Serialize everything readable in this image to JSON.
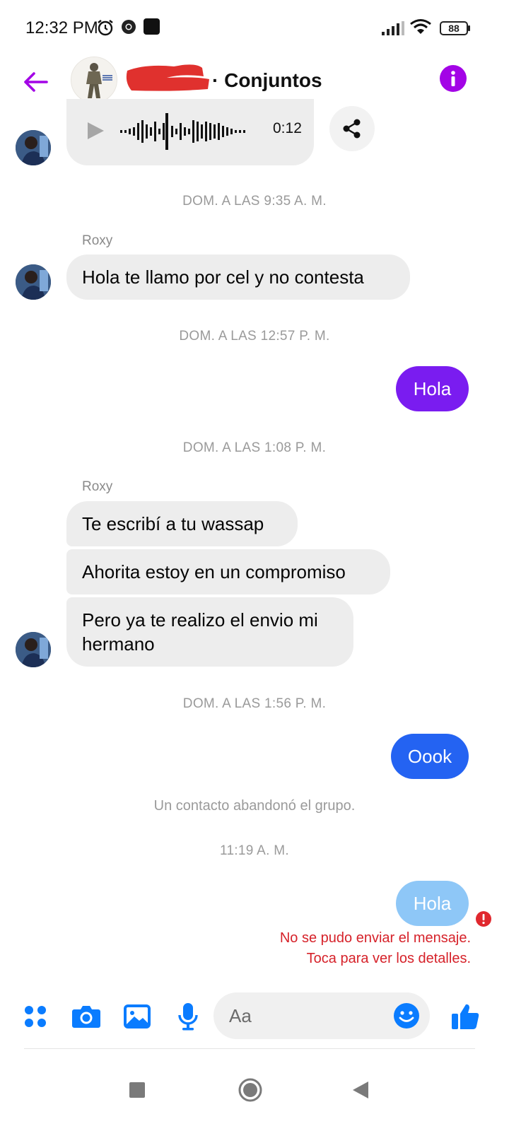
{
  "status_bar": {
    "time": "12:32 PM",
    "battery": "88",
    "icons": [
      "alarm-icon",
      "chrome-icon",
      "notification-icon",
      "signal-icon",
      "wifi-icon",
      "battery-icon"
    ]
  },
  "header": {
    "title": "· Conjuntos",
    "back_icon": "arrow-left-icon",
    "info_icon": "info-icon"
  },
  "colors": {
    "accent": "#a304e6",
    "outgoing_purple": "#7a1cf0",
    "outgoing_blue": "#2463f2",
    "outgoing_pending": "#8ec7f7",
    "incoming": "#ededed",
    "error": "#d6222a",
    "messenger_blue": "#0a7cff"
  },
  "conversation": {
    "audio": {
      "duration": "0:12",
      "play_icon": "play-icon",
      "share_icon": "share-icon"
    },
    "separators": [
      "DOM. A LAS 9:35 A. M.",
      "DOM. A LAS 12:57 P. M.",
      "DOM. A LAS 1:08 P. M.",
      "DOM. A LAS 1:56 P. M.",
      "11:19 A. M."
    ],
    "sender_names": [
      "Roxy",
      "Roxy"
    ],
    "incoming": [
      "Hola te llamo por cel y no contesta",
      "Te escribí a tu wassap",
      "Ahorita estoy en un compromiso",
      "Pero ya te realizo el envio mi hermano"
    ],
    "outgoing": [
      "Hola",
      "Oook",
      "Hola"
    ],
    "system_notice": "Un contacto abandonó el grupo.",
    "failed": {
      "line1": "No se pudo enviar el mensaje.",
      "line2": "Toca para ver los detalles.",
      "icon": "error-icon"
    }
  },
  "composer": {
    "placeholder": "Aa",
    "icons": [
      "menu-dots-icon",
      "camera-icon",
      "gallery-icon",
      "microphone-icon",
      "emoji-icon",
      "like-icon"
    ]
  },
  "navbar": {
    "icons": [
      "recents-icon",
      "home-icon",
      "back-icon"
    ]
  }
}
